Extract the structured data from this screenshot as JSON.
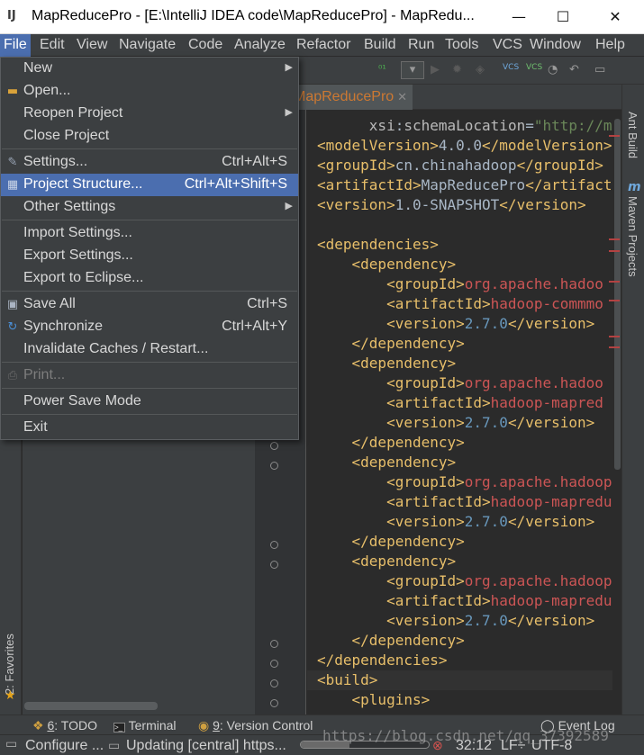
{
  "window": {
    "title": "MapReducePro - [E:\\IntelliJ IDEA code\\MapReducePro] - MapRedu...",
    "minimize": "—",
    "maximize": "☐",
    "close": "✕"
  },
  "menubar": {
    "items": [
      "File",
      "Edit",
      "View",
      "Navigate",
      "Code",
      "Analyze",
      "Refactor",
      "Build",
      "Run",
      "Tools",
      "VCS",
      "Window",
      "Help"
    ],
    "active": "File"
  },
  "file_menu": {
    "items": [
      {
        "label": "New",
        "shortcut": "",
        "submenu": true
      },
      {
        "label": "Open...",
        "shortcut": "",
        "icon": "folder-icon"
      },
      {
        "label": "Reopen Project",
        "shortcut": "",
        "submenu": true
      },
      {
        "label": "Close Project",
        "shortcut": ""
      },
      {
        "label": "Settings...",
        "shortcut": "Ctrl+Alt+S",
        "icon": "wrench-icon"
      },
      {
        "label": "Project Structure...",
        "shortcut": "Ctrl+Alt+Shift+S",
        "icon": "project-structure-icon",
        "selected": true
      },
      {
        "label": "Other Settings",
        "shortcut": "",
        "submenu": true
      },
      {
        "label": "Import Settings...",
        "shortcut": ""
      },
      {
        "label": "Export Settings...",
        "shortcut": ""
      },
      {
        "label": "Export to Eclipse...",
        "shortcut": ""
      },
      {
        "label": "Save All",
        "shortcut": "Ctrl+S",
        "icon": "save-icon"
      },
      {
        "label": "Synchronize",
        "shortcut": "Ctrl+Alt+Y",
        "icon": "sync-icon"
      },
      {
        "label": "Invalidate Caches / Restart...",
        "shortcut": ""
      },
      {
        "label": "Print...",
        "shortcut": "",
        "icon": "print-icon",
        "disabled": true
      },
      {
        "label": "Power Save Mode",
        "shortcut": ""
      },
      {
        "label": "Exit",
        "shortcut": ""
      }
    ]
  },
  "editor": {
    "tab": "MapReducePro",
    "lines": [
      {
        "parts": [
          [
            "attr",
            "      xsi"
          ],
          [
            "txt",
            ":"
          ],
          [
            "attr",
            "schemaLocation"
          ],
          [
            "txt",
            "="
          ],
          [
            "str",
            "\"http://ma"
          ]
        ]
      },
      {
        "parts": [
          [
            "tag",
            "<modelVersion>"
          ],
          [
            "txt",
            "4.0.0"
          ],
          [
            "tag",
            "</modelVersion>"
          ]
        ]
      },
      {
        "parts": [
          [
            "tag",
            "<groupId>"
          ],
          [
            "txt",
            "cn.chinahadoop"
          ],
          [
            "tag",
            "</groupId>"
          ]
        ]
      },
      {
        "parts": [
          [
            "tag",
            "<artifactId>"
          ],
          [
            "txt",
            "MapReducePro"
          ],
          [
            "tag",
            "</artifact"
          ]
        ]
      },
      {
        "parts": [
          [
            "tag",
            "<version>"
          ],
          [
            "txt",
            "1.0-SNAPSHOT"
          ],
          [
            "tag",
            "</version>"
          ]
        ]
      },
      {
        "parts": [
          [
            "txt",
            ""
          ]
        ]
      },
      {
        "parts": [
          [
            "tag",
            "<dependencies>"
          ]
        ]
      },
      {
        "parts": [
          [
            "tag",
            "    <dependency>"
          ]
        ]
      },
      {
        "parts": [
          [
            "tag",
            "        <groupId>"
          ],
          [
            "red",
            "org.apache.hadoo"
          ]
        ]
      },
      {
        "parts": [
          [
            "tag",
            "        <artifactId>"
          ],
          [
            "red",
            "hadoop-commmo"
          ]
        ]
      },
      {
        "parts": [
          [
            "tag",
            "        <version>"
          ],
          [
            "num",
            "2.7.0"
          ],
          [
            "tag",
            "</version>"
          ]
        ]
      },
      {
        "parts": [
          [
            "tag",
            "    </dependency>"
          ]
        ]
      },
      {
        "parts": [
          [
            "tag",
            "    <dependency>"
          ]
        ]
      },
      {
        "parts": [
          [
            "tag",
            "        <groupId>"
          ],
          [
            "red",
            "org.apache.hadoo"
          ]
        ]
      },
      {
        "parts": [
          [
            "tag",
            "        <artifactId>"
          ],
          [
            "red",
            "hadoop-mapred"
          ]
        ]
      },
      {
        "parts": [
          [
            "tag",
            "        <version>"
          ],
          [
            "num",
            "2.7.0"
          ],
          [
            "tag",
            "</version>"
          ]
        ]
      },
      {
        "parts": [
          [
            "tag",
            "    </dependency>"
          ]
        ]
      },
      {
        "parts": [
          [
            "tag",
            "    <dependency>"
          ]
        ]
      },
      {
        "parts": [
          [
            "tag",
            "        <groupId>"
          ],
          [
            "red",
            "org.apache.hadoop"
          ]
        ]
      },
      {
        "parts": [
          [
            "tag",
            "        <artifactId>"
          ],
          [
            "red",
            "hadoop-mapredu"
          ]
        ]
      },
      {
        "parts": [
          [
            "tag",
            "        <version>"
          ],
          [
            "num",
            "2.7.0"
          ],
          [
            "tag",
            "</version>"
          ]
        ]
      },
      {
        "parts": [
          [
            "tag",
            "    </dependency>"
          ]
        ]
      },
      {
        "parts": [
          [
            "tag",
            "    <dependency>"
          ]
        ]
      },
      {
        "parts": [
          [
            "tag",
            "        <groupId>"
          ],
          [
            "red",
            "org.apache.hadoop"
          ]
        ]
      },
      {
        "parts": [
          [
            "tag",
            "        <artifactId>"
          ],
          [
            "red",
            "hadoop-mapredu"
          ]
        ]
      },
      {
        "parts": [
          [
            "tag",
            "        <version>"
          ],
          [
            "num",
            "2.7.0"
          ],
          [
            "tag",
            "</version>"
          ]
        ]
      },
      {
        "parts": [
          [
            "tag",
            "    </dependency>"
          ]
        ]
      },
      {
        "parts": [
          [
            "tag",
            "</dependencies>"
          ]
        ]
      },
      {
        "parts": [
          [
            "tag",
            "<build>"
          ]
        ],
        "highlighted": true
      },
      {
        "parts": [
          [
            "tag",
            "    <plugins>"
          ]
        ]
      }
    ]
  },
  "right_tools": [
    "Ant Build",
    "Maven Projects"
  ],
  "left_tools": {
    "favorites": "2: Favorites"
  },
  "bottom_tools": [
    {
      "num": "6",
      "label": ": TODO",
      "icon": "todo-icon"
    },
    {
      "num": "",
      "label": "Terminal",
      "icon": "terminal-icon"
    },
    {
      "num": "9",
      "label": ": Version Control",
      "icon": "version-control-icon"
    }
  ],
  "event_log": "Event Log",
  "status": {
    "configure": "Configure ...",
    "updating": "Updating [central] https...",
    "progress": 0.38,
    "position": "32:12",
    "line_sep": "LF÷",
    "encoding": "UTF-8"
  },
  "watermark": "https://blog.csdn.net/qq_37392589"
}
